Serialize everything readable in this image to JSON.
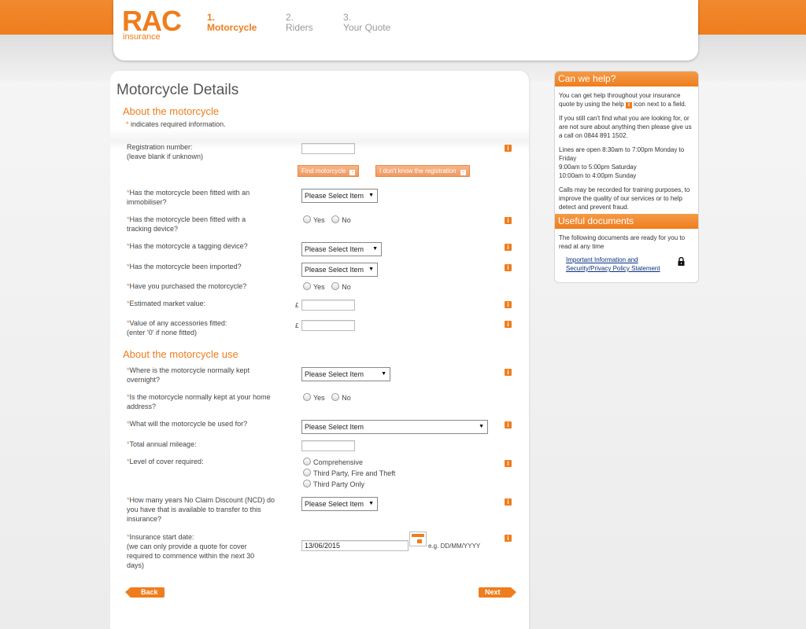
{
  "header": {
    "logo_main": "RAC",
    "logo_sub": "insurance",
    "steps": [
      {
        "num": "1.",
        "label": "Motorcycle"
      },
      {
        "num": "2.",
        "label": "Riders"
      },
      {
        "num": "3.",
        "label": "Your Quote"
      }
    ]
  },
  "main": {
    "title": "Motorcycle Details",
    "section1": "About the motorcycle",
    "required_note": {
      "star": "*",
      "text": " indicates required information."
    },
    "registration": {
      "label_line1": "Registration number:",
      "label_line2": "(leave blank if unknown)",
      "value": "",
      "find_button": "Find motorcycle",
      "unknown_button": "I don't know the registration"
    },
    "immobiliser": {
      "label": "Has the motorcycle been fitted with an immobiliser?",
      "value": "Please Select Item"
    },
    "tracking": {
      "label": "Has the motorcycle been fitted with a tracking device?",
      "yes": "Yes",
      "no": "No"
    },
    "tagging": {
      "label": "Has the motorcycle a tagging device?",
      "value": "Please Select Item"
    },
    "imported": {
      "label": "Has the motorcycle been imported?",
      "value": "Please Select Item"
    },
    "purchased": {
      "label": "Have you purchased the motorcycle?",
      "yes": "Yes",
      "no": "No"
    },
    "market_value": {
      "label": "Estimated market value:",
      "currency": "£",
      "value": ""
    },
    "accessories": {
      "label_line1": "Value of any accessories fitted:",
      "label_line2": "(enter '0' if none fitted)",
      "currency": "£",
      "value": ""
    },
    "section2": "About the motorcycle use",
    "kept_overnight": {
      "label": "Where is the motorcycle normally kept overnight?",
      "value": "Please Select Item"
    },
    "kept_home": {
      "label": "Is the motorcycle normally kept at your home address?",
      "yes": "Yes",
      "no": "No"
    },
    "usage": {
      "label": "What will the motorcycle be used for?",
      "value": "Please Select Item"
    },
    "mileage": {
      "label": "Total annual mileage:",
      "value": ""
    },
    "cover": {
      "label": "Level of cover required:",
      "options": [
        "Comprehensive",
        "Third Party, Fire and Theft",
        "Third Party Only"
      ]
    },
    "ncd": {
      "label": "How many years No Claim Discount (NCD) do you have that is available to transfer to this insurance?",
      "value": "Please Select Item"
    },
    "start_date": {
      "label_line1": "Insurance start date:",
      "label_line2": "(we can only provide a quote for cover required to commence within the next 30 days)",
      "value": "13/06/2015",
      "format_hint": "e.g. DD/MM/YYYY"
    },
    "star": "*",
    "info_glyph": "i",
    "arrow_glyph": "▼",
    "back_button": "Back",
    "next_button": "Next"
  },
  "sidebar": {
    "help_title": "Can we help?",
    "help_p1a": "You can get help throughout your insurance quote by using the help ",
    "help_p1b": " icon next to a field.",
    "help_p2": "If you still can't find what you are looking for, or are not sure about anything then please give us a call on 0844 891 1502.",
    "hours_line1": "Lines are open 8:30am to 7:00pm Monday to Friday",
    "hours_line2": "9:00am to 5:00pm Saturday",
    "hours_line3": "10:00am to 4:00pm Sunday",
    "help_p4": "Calls may be recorded for training purposes, to improve the quality of our services or to help detect and prevent fraud.",
    "docs_title": "Useful documents",
    "docs_intro": "The following documents are ready for you to read at any time",
    "doc_link1": "Important Information and",
    "doc_link2": "Security/Privacy Policy Statement"
  },
  "colors": {
    "accent": "#ef7d1d",
    "link": "#0a2f7d"
  }
}
